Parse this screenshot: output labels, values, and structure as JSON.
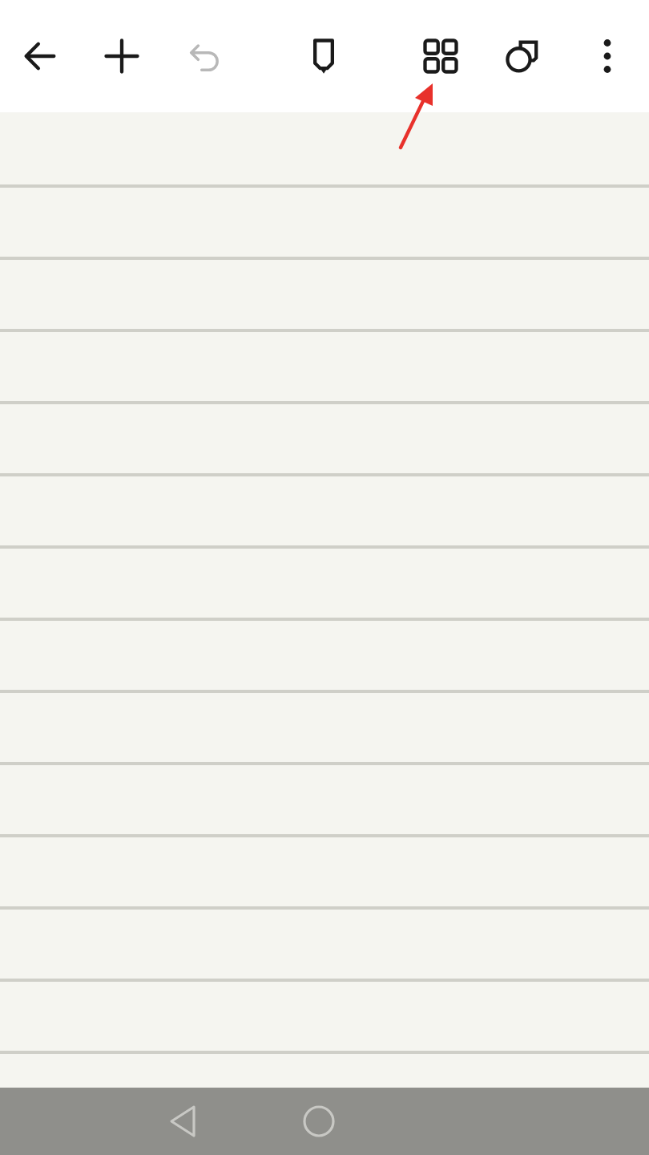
{
  "toolbar": [
    {
      "kind": "back",
      "disabled": false
    },
    {
      "kind": "add",
      "disabled": false
    },
    {
      "kind": "undo",
      "disabled": true
    },
    {
      "kind": "pen",
      "disabled": false
    },
    {
      "kind": "grid",
      "disabled": false
    },
    {
      "kind": "shapes",
      "disabled": false
    },
    {
      "kind": "more",
      "disabled": false
    }
  ],
  "annotations": [
    {
      "kind": "arrow",
      "color": "#e8312b"
    }
  ],
  "nav_bar": [
    {
      "kind": "back"
    },
    {
      "kind": "home"
    }
  ]
}
